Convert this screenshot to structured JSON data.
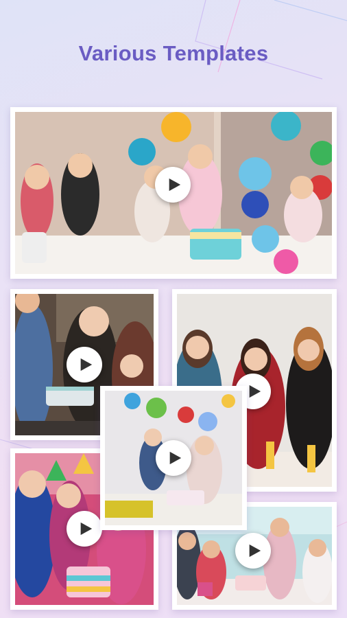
{
  "header": {
    "title": "Various Templates"
  },
  "colors": {
    "title": "#6a5cc3",
    "accent_pink": "#f0a9d8",
    "accent_blue": "#8ab4f0"
  },
  "icons": {
    "play": "play-icon"
  },
  "templates": [
    {
      "name": "birthday-party-kids",
      "scene": "children at a birthday table with cake and balloons"
    },
    {
      "name": "birthday-cake-friends",
      "scene": "friends clapping around a birthday cake"
    },
    {
      "name": "three-girls-party",
      "scene": "three girls at a celebration table"
    },
    {
      "name": "toddler-party",
      "scene": "toddler at a party with balloons"
    },
    {
      "name": "kids-with-cake",
      "scene": "kids with party hats and a cake"
    },
    {
      "name": "kids-table-celebration",
      "scene": "children celebrating around a table"
    }
  ]
}
